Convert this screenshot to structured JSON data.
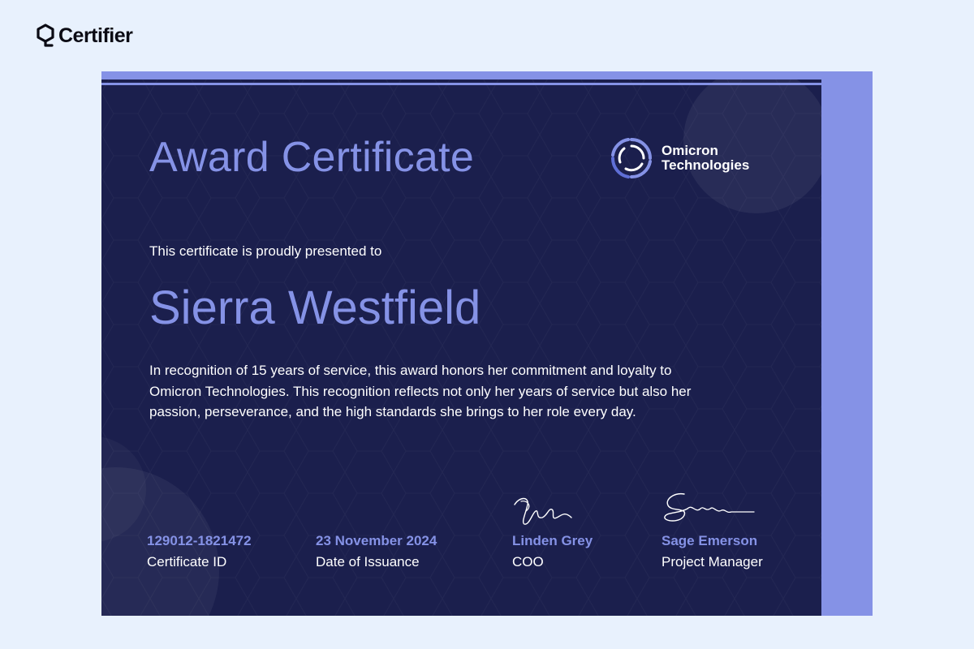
{
  "brand": {
    "name": "Certifier",
    "icon": "certifier-logo-icon"
  },
  "certificate": {
    "title": "Award Certificate",
    "company": {
      "line1": "Omicron",
      "line2": "Technologies",
      "icon": "omicron-logo-icon"
    },
    "presented_text": "This certificate is proudly presented to",
    "recipient": "Sierra Westfield",
    "description": "In recognition of  15 years of service, this award honors her commitment and loyalty to Omicron Technologies. This recognition reflects not only her years of service but also her passion, perseverance, and the high standards she brings to her role every day.",
    "certificate_id": {
      "value": "129012-1821472",
      "label": "Certificate ID"
    },
    "issue_date": {
      "value": "23 November 2024",
      "label": "Date of Issuance"
    },
    "signatories": [
      {
        "name": "Linden Grey",
        "role": "COO"
      },
      {
        "name": "Sage Emerson",
        "role": "Project Manager"
      }
    ],
    "colors": {
      "background": "#1b1f4d",
      "accent": "#8592e6",
      "page": "#e8f1fd"
    }
  }
}
